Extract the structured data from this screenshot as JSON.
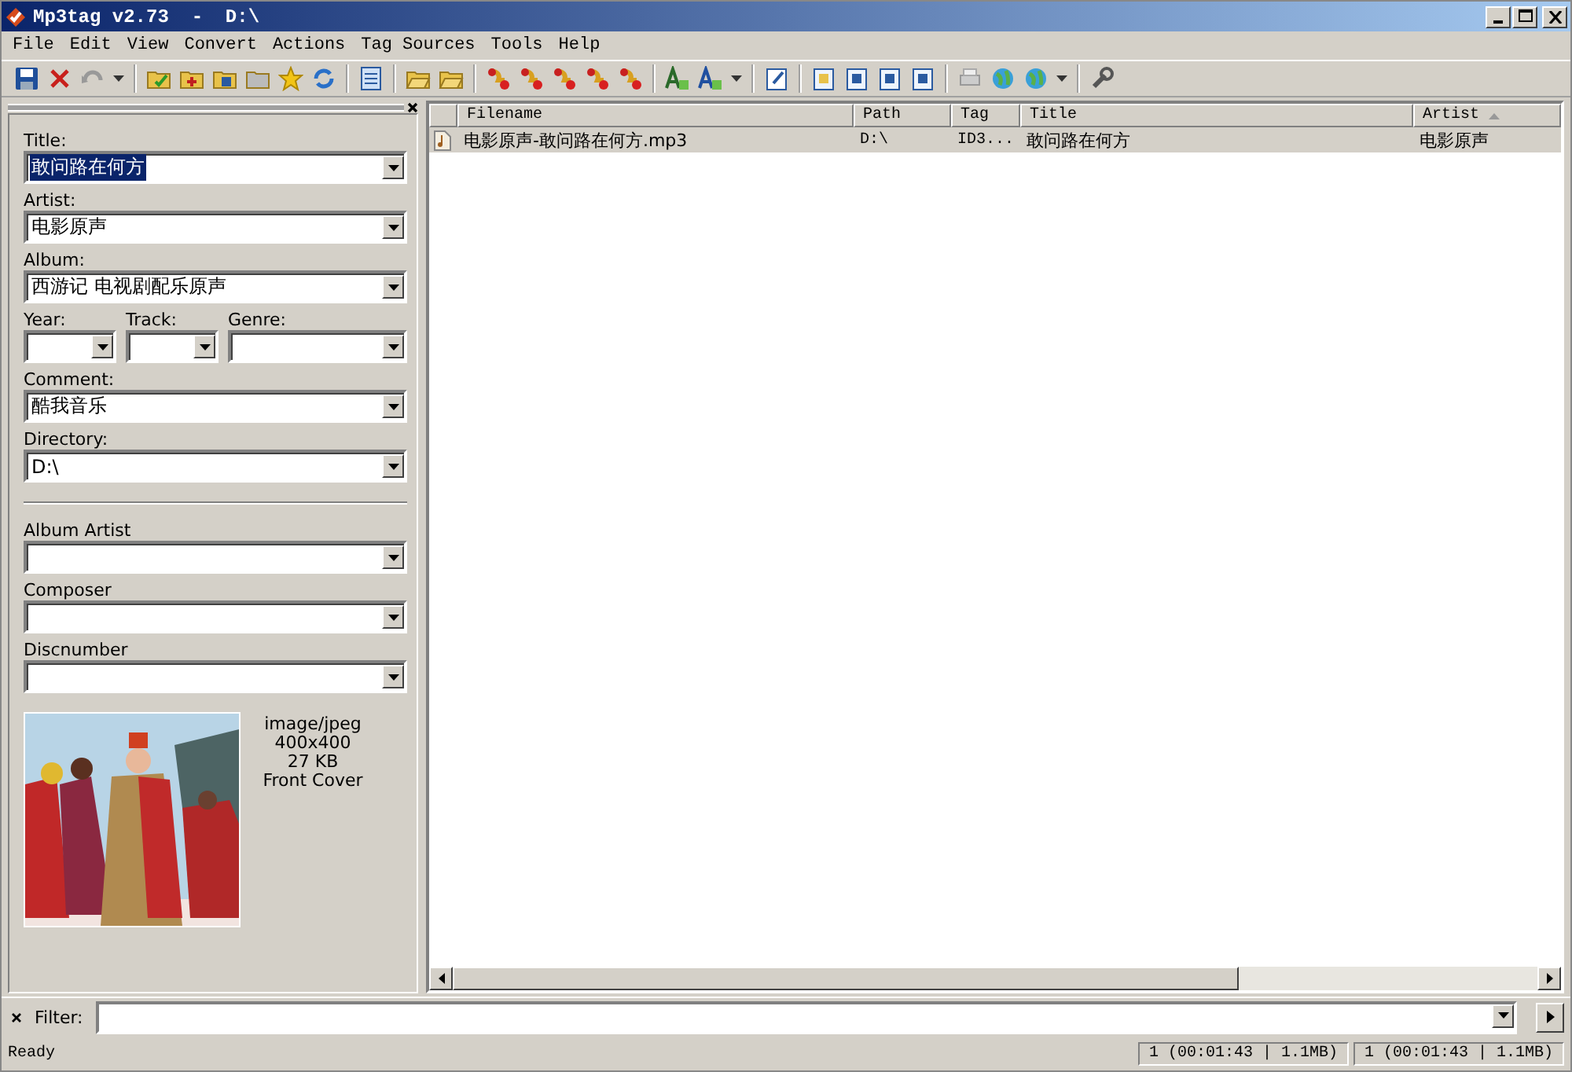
{
  "window": {
    "title": "Mp3tag v2.73  -  D:\\"
  },
  "menu": [
    "File",
    "Edit",
    "View",
    "Convert",
    "Actions",
    "Tag Sources",
    "Tools",
    "Help"
  ],
  "tag_panel": {
    "fields": [
      {
        "kind": "field",
        "label": "Title:",
        "value": "敢问路在何方",
        "selected": true
      },
      {
        "kind": "field",
        "label": "Artist:",
        "value": "电影原声",
        "selected": false
      },
      {
        "kind": "field",
        "label": "Album:",
        "value": "西游记 电视剧配乐原声",
        "selected": false
      },
      {
        "kind": "row",
        "items": [
          {
            "label": "Year:"
          },
          {
            "label": "Track:"
          },
          {
            "label": "Genre:"
          }
        ]
      },
      {
        "kind": "field",
        "label": "Comment:",
        "value": "酷我音乐",
        "selected": false
      },
      {
        "kind": "field",
        "label": "Directory:",
        "value": "D:\\",
        "selected": false
      },
      {
        "kind": "separator"
      },
      {
        "kind": "field",
        "label": "Album Artist"
      },
      {
        "kind": "field",
        "label": "Composer"
      },
      {
        "kind": "field",
        "label": "Discnumber"
      }
    ],
    "cover": {
      "kind": "picture",
      "details": [
        "image/jpeg",
        "400x400",
        "27 KB",
        "Front Cover"
      ]
    }
  },
  "file_list": {
    "columns": [
      {
        "label": "Filename",
        "sorted": false
      },
      {
        "label": "Path",
        "sorted": false
      },
      {
        "label": "Tag",
        "sorted": false
      },
      {
        "label": "Title",
        "sorted": false
      },
      {
        "label": "Artist",
        "sorted": true
      }
    ],
    "rows": [
      {
        "selected": true,
        "cells": [
          "电影原声-敢问路在何方.mp3",
          "D:\\",
          "ID3...",
          "敢问路在何方",
          "电影原声"
        ]
      }
    ]
  },
  "filter": {
    "label": "Filter:"
  },
  "status_bar": {
    "text": "Ready",
    "panels": [
      "1 (00:01:43 | 1.1MB)",
      "1 (00:01:43 | 1.1MB)"
    ]
  }
}
